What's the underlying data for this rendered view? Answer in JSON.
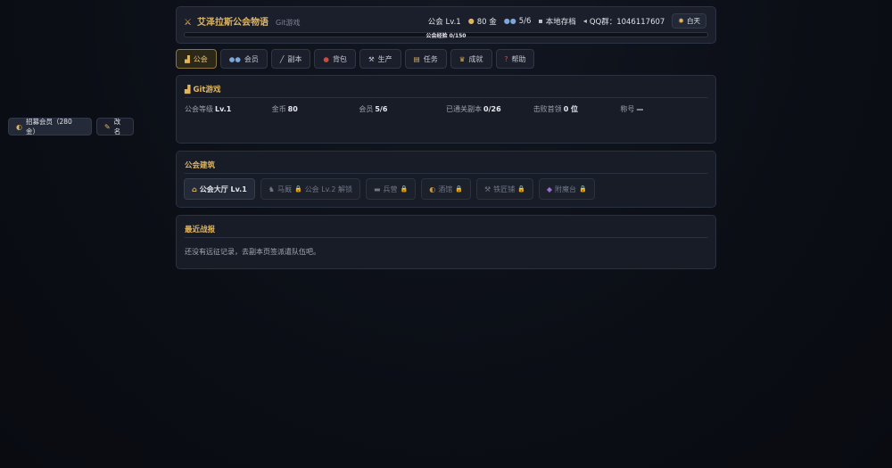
{
  "header": {
    "icon": "crossed-swords-icon",
    "title": "艾泽拉斯公会物语",
    "subtitle": "Git游戏",
    "guild_level": "公会 Lv.1",
    "gold": "80 金",
    "members": "5/6",
    "save": "本地存档",
    "qq": "QQ群：1046117607",
    "day_toggle": "白天",
    "xp_label": "公会经验 0/150",
    "xp_progress": 0
  },
  "tabs": [
    {
      "label": "公会",
      "icon": "guild-chart-icon",
      "active": true
    },
    {
      "label": "会员",
      "icon": "members-icon",
      "active": false
    },
    {
      "label": "副本",
      "icon": "dungeon-wand-icon",
      "active": false
    },
    {
      "label": "背包",
      "icon": "bag-icon",
      "active": false
    },
    {
      "label": "生产",
      "icon": "pickaxe-icon",
      "active": false
    },
    {
      "label": "任务",
      "icon": "scroll-icon",
      "active": false
    },
    {
      "label": "成就",
      "icon": "trophy-icon",
      "active": false
    },
    {
      "label": "帮助",
      "icon": "question-icon",
      "active": false
    }
  ],
  "guild_panel": {
    "title": "Git游戏",
    "stats": [
      {
        "label": "公会等级",
        "value": "Lv.1"
      },
      {
        "label": "金币",
        "value": "80"
      },
      {
        "label": "会员",
        "value": "5/6"
      },
      {
        "label": "已通关副本",
        "value": "0/26"
      },
      {
        "label": "击败首领",
        "value": "0 位"
      },
      {
        "label": "称号",
        "value": "—"
      }
    ],
    "recruit_button": "招募会员（280 金）",
    "rename_button": "改名"
  },
  "buildings_panel": {
    "title": "公会建筑",
    "buildings": [
      {
        "label": "公会大厅 Lv.1",
        "icon": "house-icon",
        "locked": false
      },
      {
        "label": "马厩",
        "icon": "horse-icon",
        "locked": true,
        "note": "公会 Lv.2 解锁"
      },
      {
        "label": "兵营",
        "icon": "bed-icon",
        "locked": true
      },
      {
        "label": "酒馆",
        "icon": "tavern-icon",
        "locked": true
      },
      {
        "label": "铁匠铺",
        "icon": "hammer-icon",
        "locked": true
      },
      {
        "label": "附魔台",
        "icon": "crystal-icon",
        "locked": true
      }
    ]
  },
  "log_panel": {
    "title": "最近战报",
    "empty_text": "还没有远征记录，去副本页签派遣队伍吧。"
  },
  "colors": {
    "accent_gold": "#e0b55e",
    "panel_bg": "#171c27",
    "page_bg": "#0b0e15"
  }
}
